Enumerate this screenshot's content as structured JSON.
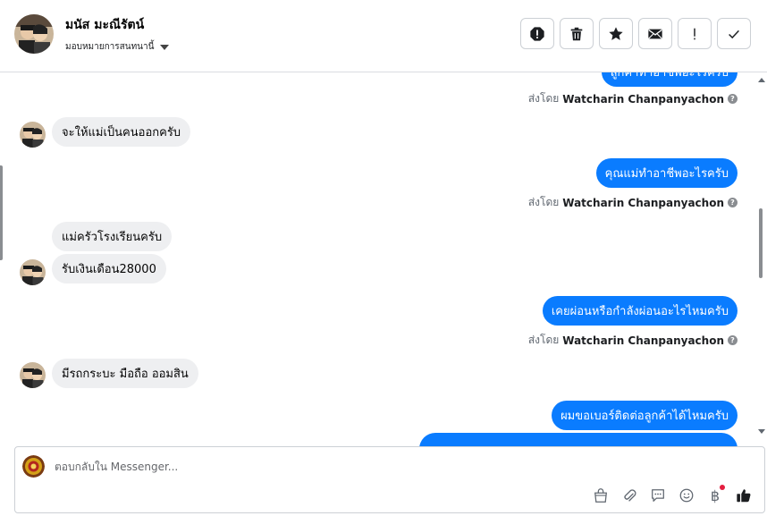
{
  "header": {
    "name": "มนัส มะณีรัตน์",
    "assign_label": "มอบหมายการสนทนานี้"
  },
  "toolbar": {
    "buttons": [
      "spam-icon",
      "trash-icon",
      "star-icon",
      "mail-icon",
      "exclamation-icon",
      "check-icon"
    ]
  },
  "messages": [
    {
      "dir": "out",
      "text": "ลูกค้าทำอาชีพอะไรครับ",
      "partial": "top"
    },
    {
      "dir": "meta",
      "sent_by_label": "ส่งโดย",
      "sender": "Watcharin Chanpanyachon"
    },
    {
      "dir": "in",
      "text": "จะให้แม่เป็นคนออกครับ"
    },
    {
      "dir": "out",
      "text": "คุณแม่ทำอาชีพอะไรครับ"
    },
    {
      "dir": "meta",
      "sent_by_label": "ส่งโดย",
      "sender": "Watcharin Chanpanyachon"
    },
    {
      "dir": "in",
      "text": "แม่ครัวโรงเรียนครับ"
    },
    {
      "dir": "in",
      "text": "รับเงินเดือน28000"
    },
    {
      "dir": "out",
      "text": "เคยผ่อนหรือกำลังผ่อนอะไรไหมครับ"
    },
    {
      "dir": "meta",
      "sent_by_label": "ส่งโดย",
      "sender": "Watcharin Chanpanyachon"
    },
    {
      "dir": "in",
      "text": "มีรถกระบะ มือถือ ออมสิน"
    },
    {
      "dir": "out",
      "text": "ผมขอเบอร์ติดต่อลูกค้าได้ไหมครับ"
    }
  ],
  "composer": {
    "placeholder": "ตอบกลับใน Messenger...",
    "tools": [
      "bag-icon",
      "paperclip-icon",
      "chat-icon",
      "smile-icon",
      "baht-icon",
      "like-icon"
    ],
    "baht_symbol": "฿"
  },
  "colors": {
    "outgoing": "#0a7cff",
    "incoming": "#eeeff1",
    "notification": "#e41e3f"
  }
}
